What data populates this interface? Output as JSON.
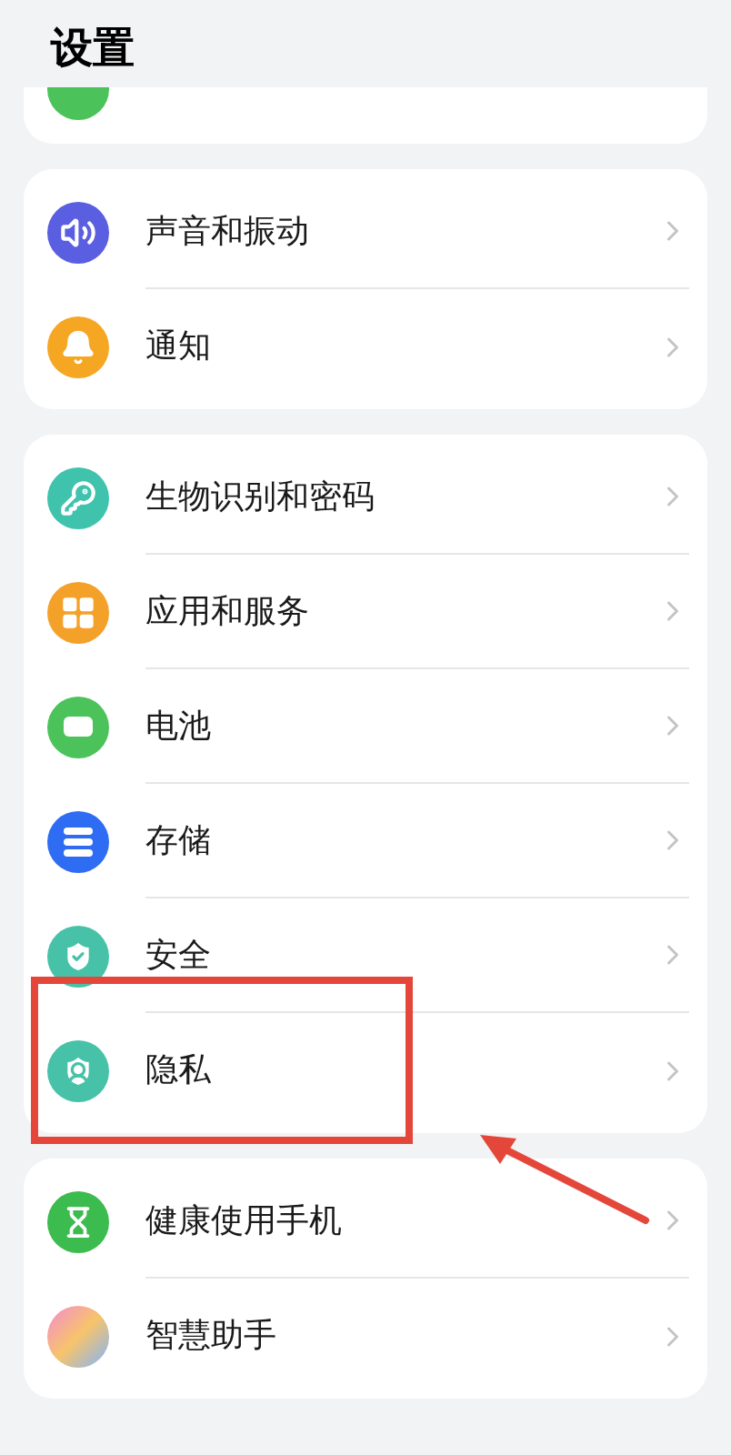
{
  "title": "设置",
  "groups": [
    {
      "items": [
        {
          "label": "声音和振动",
          "kind": "sound",
          "highlighted": false
        },
        {
          "label": "通知",
          "kind": "bell",
          "highlighted": false
        }
      ]
    },
    {
      "items": [
        {
          "label": "生物识别和密码",
          "kind": "key",
          "highlighted": false
        },
        {
          "label": "应用和服务",
          "kind": "apps",
          "highlighted": false
        },
        {
          "label": "电池",
          "kind": "battery",
          "highlighted": false
        },
        {
          "label": "存储",
          "kind": "storage",
          "highlighted": false
        },
        {
          "label": "安全",
          "kind": "security",
          "highlighted": false
        },
        {
          "label": "隐私",
          "kind": "privacy",
          "highlighted": true
        }
      ]
    },
    {
      "items": [
        {
          "label": "健康使用手机",
          "kind": "hourglass",
          "highlighted": false
        },
        {
          "label": "智慧助手",
          "kind": "orb",
          "highlighted": false
        }
      ]
    }
  ]
}
